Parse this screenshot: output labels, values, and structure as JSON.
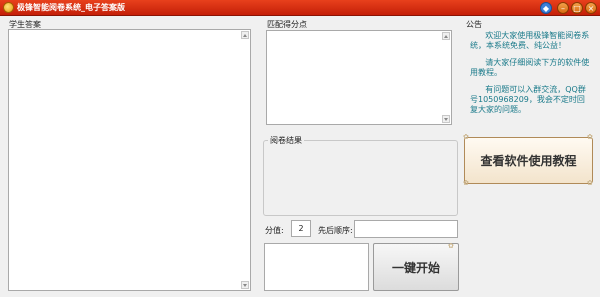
{
  "window": {
    "title": "极锋智能阅卷系统_电子答案版"
  },
  "controls": {
    "skin": "◆",
    "minimize": "–",
    "maximize": "□",
    "close": "×"
  },
  "left": {
    "student_answer_label": "学生答案"
  },
  "middle": {
    "match_points_label": "匹配得分点",
    "result_label": "阅卷结果",
    "score_label": "分值:",
    "score_value": "2",
    "order_label": "先后顺序:",
    "order_value": ""
  },
  "notice": {
    "label": "公告",
    "paragraphs": [
      "      欢迎大家使用极锋智能阅卷系统，本系统免费、纯公益！",
      "      请大家仔细阅读下方的软件使用教程。",
      "      有问题可以入群交流，QQ群号1050968209，我会不定时回复大家的问题。"
    ]
  },
  "buttons": {
    "tutorial": "查看软件使用教程",
    "start": "一键开始"
  },
  "colors": {
    "title_bar": "#d4300f",
    "notice_text": "#1a7a8a"
  }
}
